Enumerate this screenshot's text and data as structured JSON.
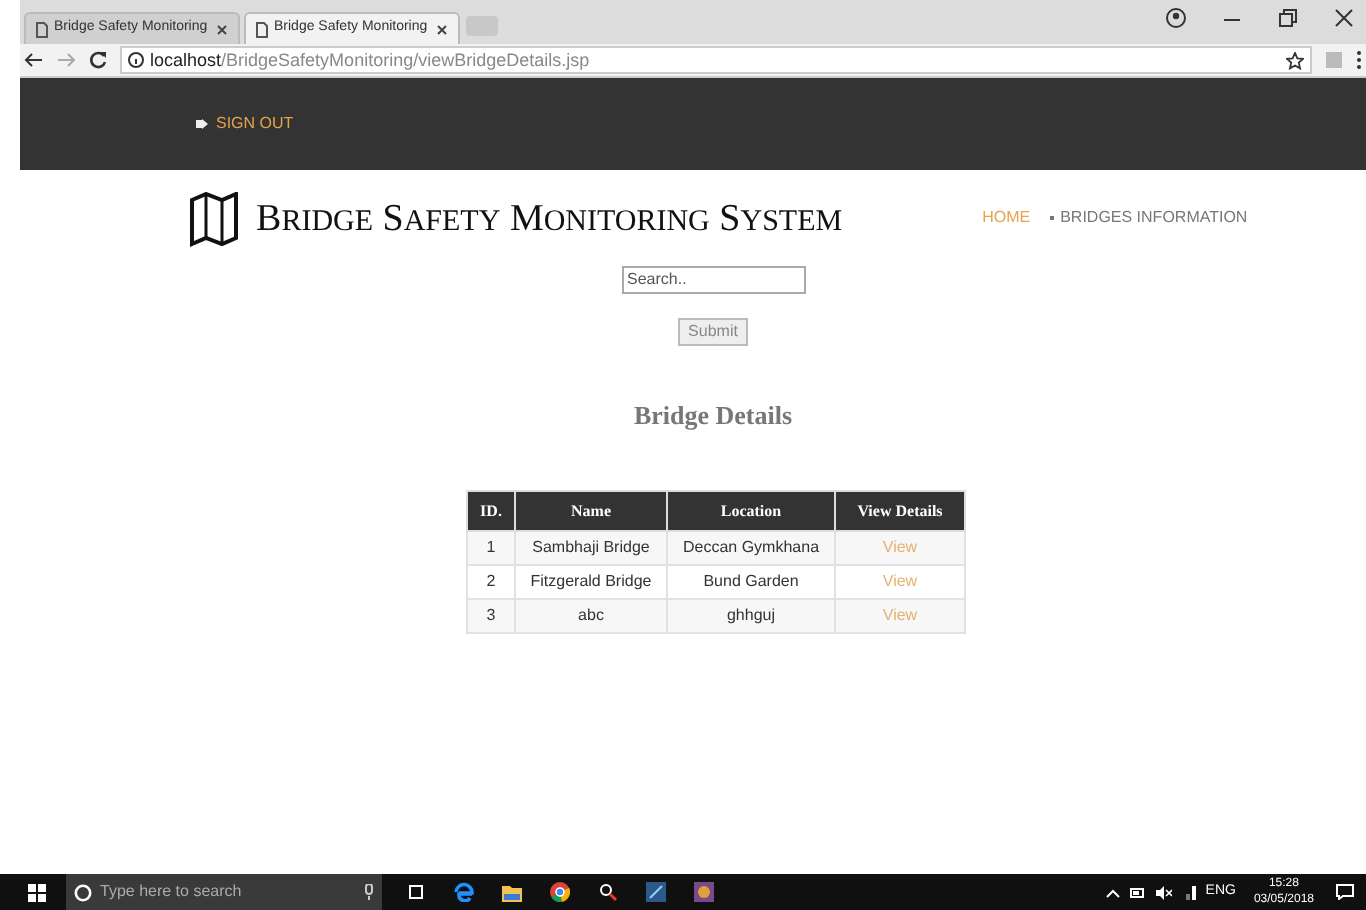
{
  "browser": {
    "tabs": [
      {
        "title": "Bridge Safety Monitoring",
        "selected": false
      },
      {
        "title": "Bridge Safety Monitoring",
        "selected": true
      }
    ],
    "url_host": "localhost",
    "url_path": "/BridgeSafetyMonitoring/viewBridgeDetails.jsp"
  },
  "navbar": {
    "sign_out": "SIGN OUT"
  },
  "header": {
    "title": "BRIDGE SAFETY MONITORING SYSTEM",
    "nav": [
      {
        "label": "HOME",
        "selected": true
      },
      {
        "label": "BRIDGES INFORMATION",
        "selected": false
      }
    ]
  },
  "search": {
    "placeholder": "Search..",
    "button": "Submit"
  },
  "heading": "Bridge Details",
  "table": {
    "columns": [
      "ID.",
      "Name",
      "Location",
      "View Details"
    ],
    "rows": [
      {
        "id": "1",
        "name": "Sambhaji Bridge",
        "location": "Deccan Gymkhana",
        "link": "View"
      },
      {
        "id": "2",
        "name": "Fitzgerald Bridge",
        "location": "Bund Garden",
        "link": "View"
      },
      {
        "id": "3",
        "name": "abc",
        "location": "ghhguj",
        "link": "View"
      }
    ]
  },
  "taskbar": {
    "search_placeholder": "Type here to search",
    "language": "ENG",
    "time": "15:28",
    "date": "03/05/2018"
  }
}
